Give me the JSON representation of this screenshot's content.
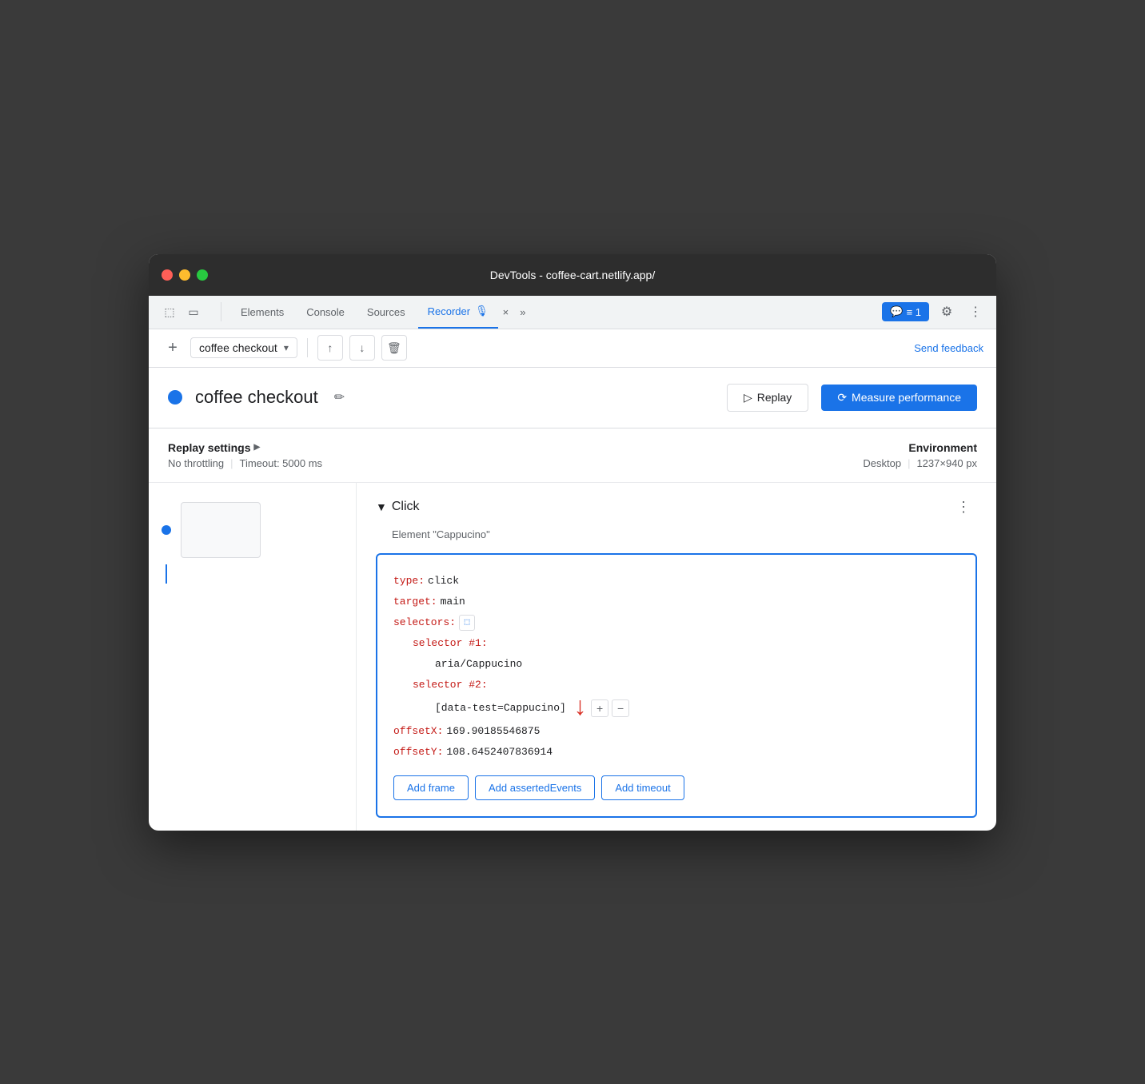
{
  "titlebar": {
    "title": "DevTools - coffee-cart.netlify.app/"
  },
  "tabs": {
    "items": [
      {
        "label": "Elements",
        "active": false
      },
      {
        "label": "Console",
        "active": false
      },
      {
        "label": "Sources",
        "active": false
      },
      {
        "label": "Recorder",
        "active": true
      },
      {
        "label": "»",
        "active": false
      }
    ],
    "recorder_badge": "🎙",
    "close_icon": "×",
    "chat_count": "≡ 1"
  },
  "toolbar": {
    "add_label": "+",
    "recording_name": "coffee checkout",
    "send_feedback": "Send feedback"
  },
  "recording_header": {
    "title": "coffee checkout",
    "replay_label": "Replay",
    "measure_label": "Measure performance"
  },
  "settings": {
    "title": "Replay settings",
    "triangle": "▶",
    "no_throttling": "No throttling",
    "timeout": "Timeout: 5000 ms",
    "env_title": "Environment",
    "desktop": "Desktop",
    "resolution": "1237×940 px"
  },
  "step": {
    "type": "Click",
    "subtitle": "Element \"Cappucino\"",
    "collapse_icon": "▼",
    "more_icon": "⋮",
    "code": {
      "type_key": "type:",
      "type_val": "click",
      "target_key": "target:",
      "target_val": "main",
      "selectors_key": "selectors:",
      "selector1_key": "selector #1:",
      "selector1_val": "aria/Cappucino",
      "selector2_key": "selector #2:",
      "selector2_val": "[data-test=Cappucino]",
      "offsetX_key": "offsetX:",
      "offsetX_val": "169.90185546875",
      "offsetY_key": "offsetY:",
      "offsetY_val": "108.6452407836914"
    },
    "add_frame": "Add frame",
    "add_asserted": "Add assertedEvents",
    "add_timeout": "Add timeout"
  }
}
